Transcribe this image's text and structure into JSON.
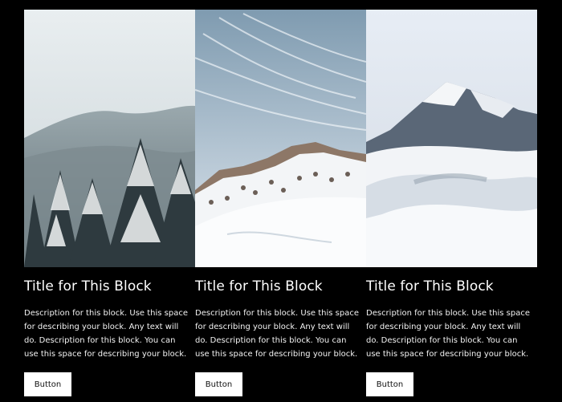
{
  "blocks": [
    {
      "title": "Title for This Block",
      "description": "Description for this block. Use this space for describing your block. Any text will do. Description for this block. You can use this space for describing your block.",
      "button_label": "Button",
      "image": "snowy-pine-forest-photo"
    },
    {
      "title": "Title for This Block",
      "description": "Description for this block. Use this space for describing your block. Any text will do. Description for this block. You can use this space for describing your block.",
      "button_label": "Button",
      "image": "snowy-ridge-under-wispy-sky-photo"
    },
    {
      "title": "Title for This Block",
      "description": "Description for this block. Use this space for describing your block. Any text will do. Description for this block. You can use this space for describing your block.",
      "button_label": "Button",
      "image": "mountain-peak-above-clouds-photo"
    }
  ],
  "colors": {
    "background": "#000000",
    "text": "#ffffff",
    "button_bg": "#ffffff",
    "button_text": "#111111"
  }
}
